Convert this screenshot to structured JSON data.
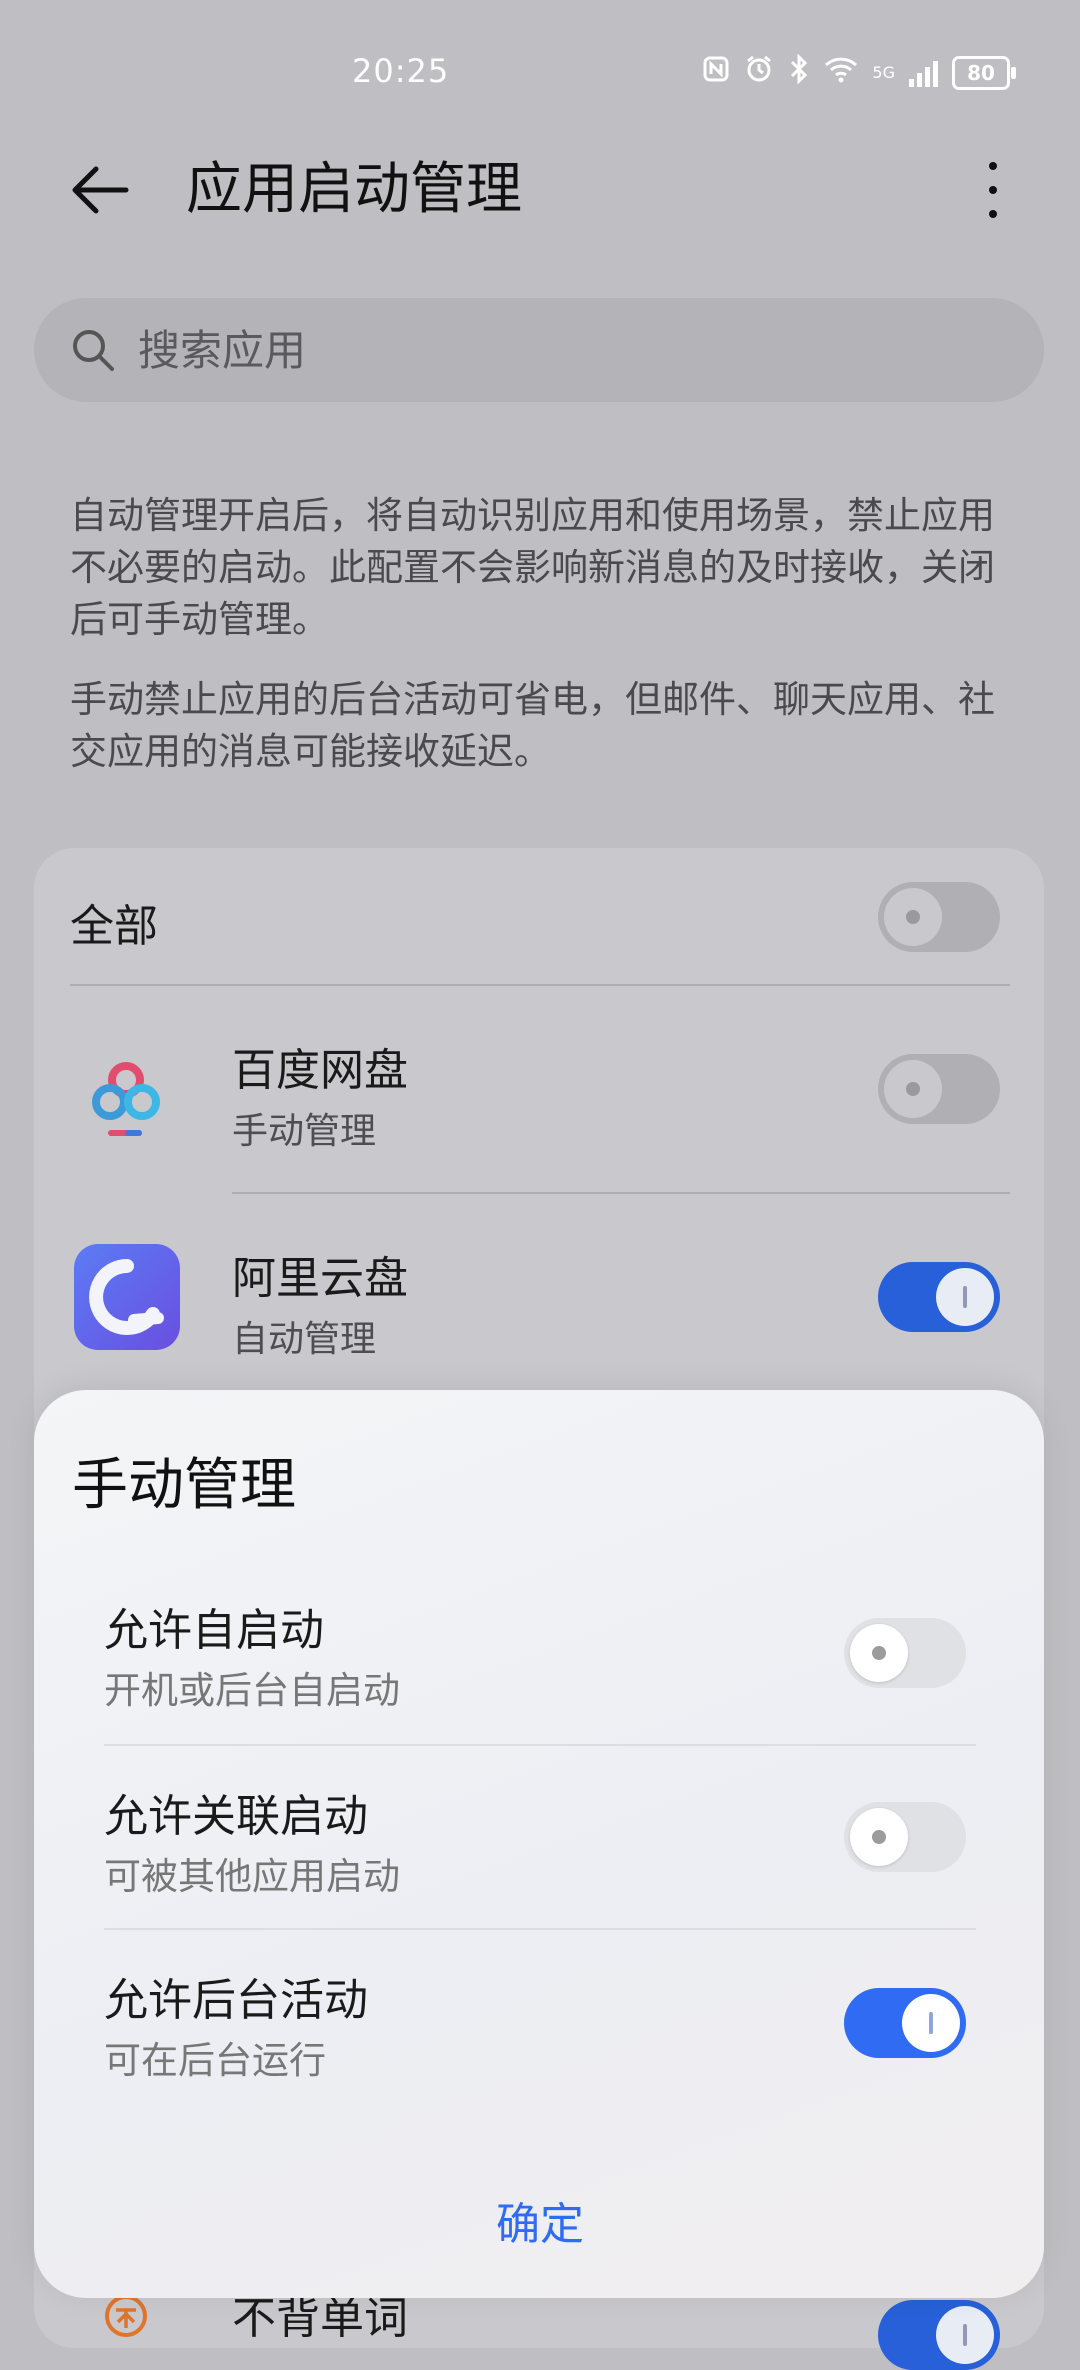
{
  "status_bar": {
    "time": "20:25",
    "network": "5G",
    "battery": "80"
  },
  "header": {
    "title": "应用启动管理"
  },
  "search": {
    "placeholder": "搜索应用"
  },
  "description": {
    "paragraph1": "自动管理开启后，将自动识别应用和使用场景，禁止应用不必要的启动。此配置不会影响新消息的及时接收，关闭后可手动管理。",
    "paragraph2": "手动禁止应用的后台活动可省电，但邮件、聊天应用、社交应用的消息可能接收延迟。"
  },
  "list": {
    "all_label": "全部",
    "all_enabled": false,
    "apps": [
      {
        "name": "百度网盘",
        "mode": "手动管理",
        "enabled": false,
        "icon": "baidu-netdisk-icon"
      },
      {
        "name": "阿里云盘",
        "mode": "自动管理",
        "enabled": true,
        "icon": "aliyun-drive-icon"
      },
      {
        "name": "不背单词",
        "mode": "",
        "enabled": true,
        "icon": "bubei-words-icon"
      }
    ]
  },
  "sheet": {
    "title": "手动管理",
    "options": [
      {
        "label": "允许自启动",
        "sub": "开机或后台自启动",
        "enabled": false
      },
      {
        "label": "允许关联启动",
        "sub": "可被其他应用启动",
        "enabled": false
      },
      {
        "label": "允许后台活动",
        "sub": "可在后台运行",
        "enabled": true
      }
    ],
    "confirm_label": "确定"
  },
  "colors": {
    "accent": "#2f6cf3",
    "toggle_on_dim": "#2760d8"
  }
}
